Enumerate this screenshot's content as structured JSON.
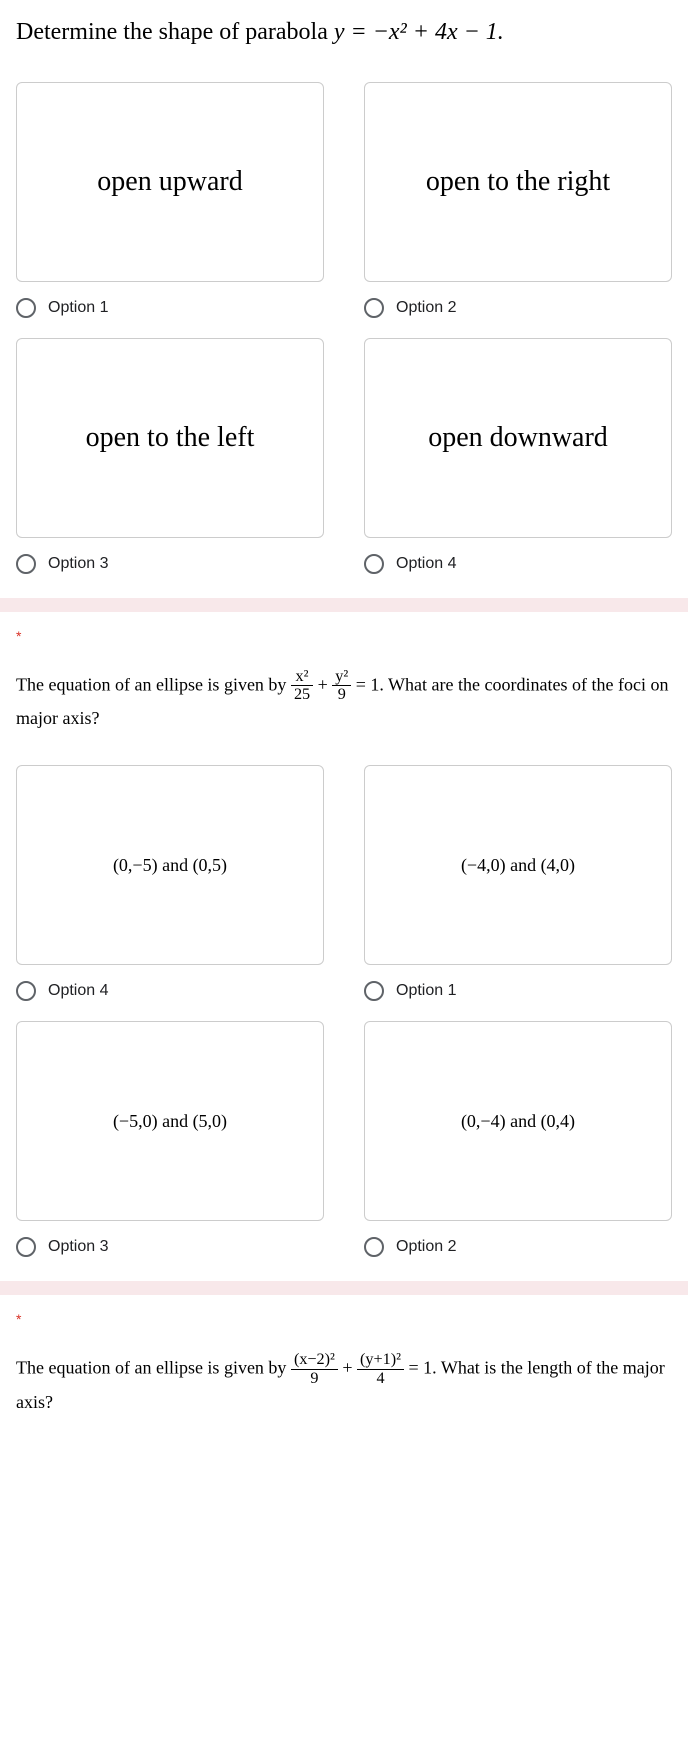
{
  "q1": {
    "prompt_prefix": "Determine the shape of parabola ",
    "prompt_equation": "y = −x² + 4x − 1.",
    "options": [
      {
        "card": "open upward",
        "label": "Option 1"
      },
      {
        "card": "open to the right",
        "label": "Option 2"
      },
      {
        "card": "open to the left",
        "label": "Option 3"
      },
      {
        "card": "open downward",
        "label": "Option 4"
      }
    ]
  },
  "q2": {
    "required": "*",
    "prompt_prefix": "The equation of an ellipse is given by ",
    "prompt_frac1_num": "x²",
    "prompt_frac1_den": "25",
    "prompt_plus": " + ",
    "prompt_frac2_num": "y²",
    "prompt_frac2_den": "9",
    "prompt_suffix": " = 1. What are the coordinates of the foci on major axis?",
    "options": [
      {
        "card": "(0,−5) and (0,5)",
        "label": "Option 4"
      },
      {
        "card": "(−4,0) and (4,0)",
        "label": "Option 1"
      },
      {
        "card": "(−5,0) and (5,0)",
        "label": "Option 3"
      },
      {
        "card": "(0,−4) and (0,4)",
        "label": "Option 2"
      }
    ]
  },
  "q3": {
    "required": "*",
    "prompt_prefix": "The equation of an ellipse is given by ",
    "prompt_frac1_num": "(x−2)²",
    "prompt_frac1_den": "9",
    "prompt_plus": " + ",
    "prompt_frac2_num": "(y+1)²",
    "prompt_frac2_den": "4",
    "prompt_suffix": " = 1. What is the length of the major axis?"
  }
}
